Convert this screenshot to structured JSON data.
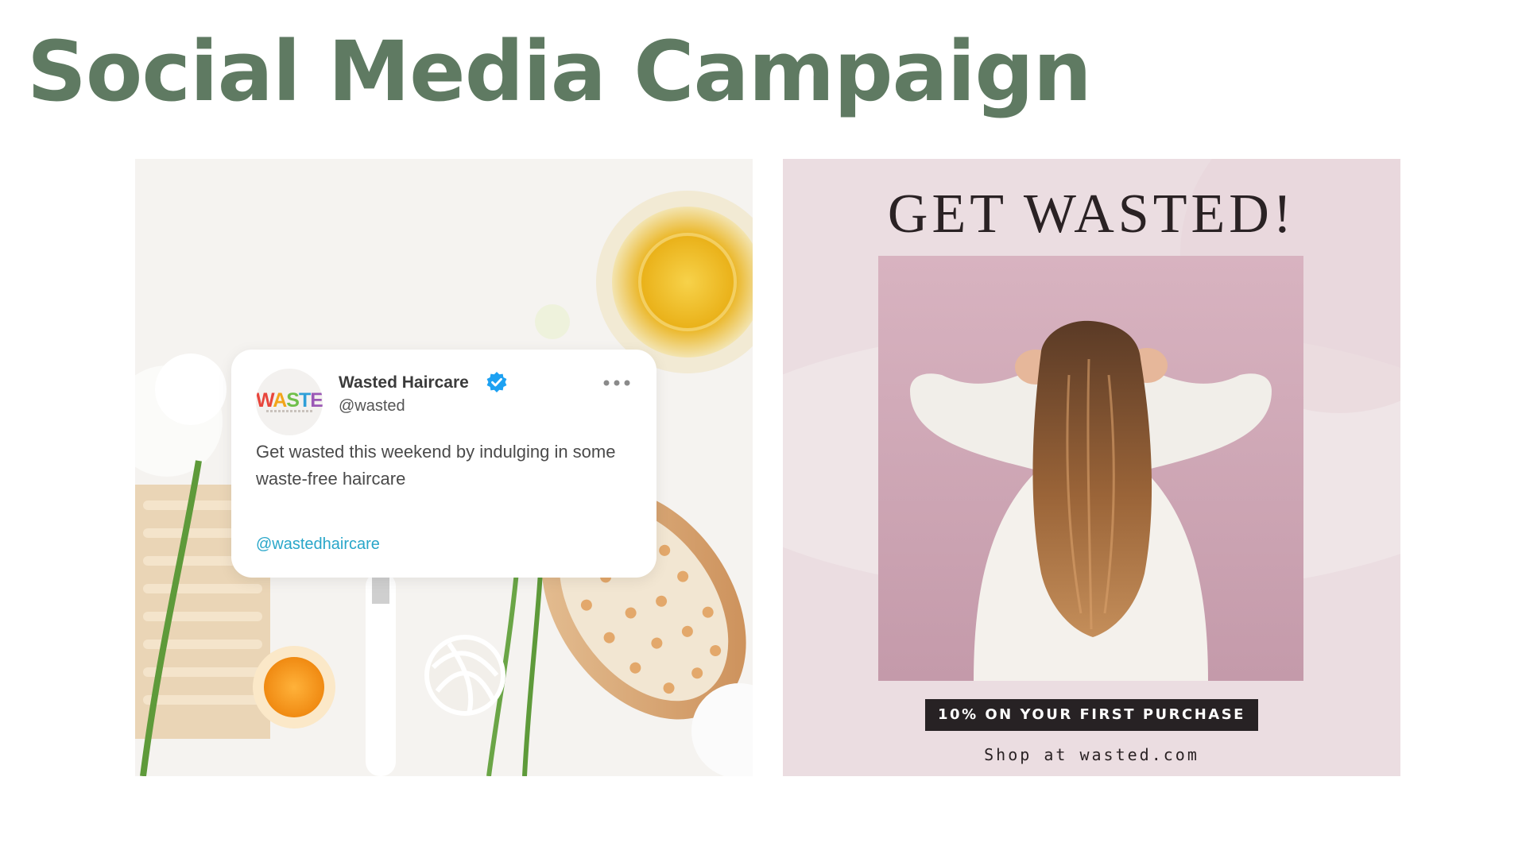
{
  "page": {
    "title": "Social Media Campaign"
  },
  "tweet": {
    "logo_text": "WASTED",
    "display_name": "Wasted Haircare",
    "handle": "@wasted",
    "body": "Get wasted this weekend by indulging in some waste-free haircare",
    "link": "@wastedhaircare",
    "icons": {
      "verified": "verified-badge-icon",
      "more": "more-options-icon"
    },
    "colors": {
      "verified": "#1da1f2",
      "link": "#28a6c9"
    }
  },
  "promo": {
    "headline": "GET WASTED!",
    "offer": "10% ON YOUR FIRST PURCHASE",
    "shop_line": "Shop at wasted.com",
    "colors": {
      "background": "#ebdde1",
      "badge": "#272224"
    }
  },
  "colors": {
    "title": "#5f7a62"
  }
}
